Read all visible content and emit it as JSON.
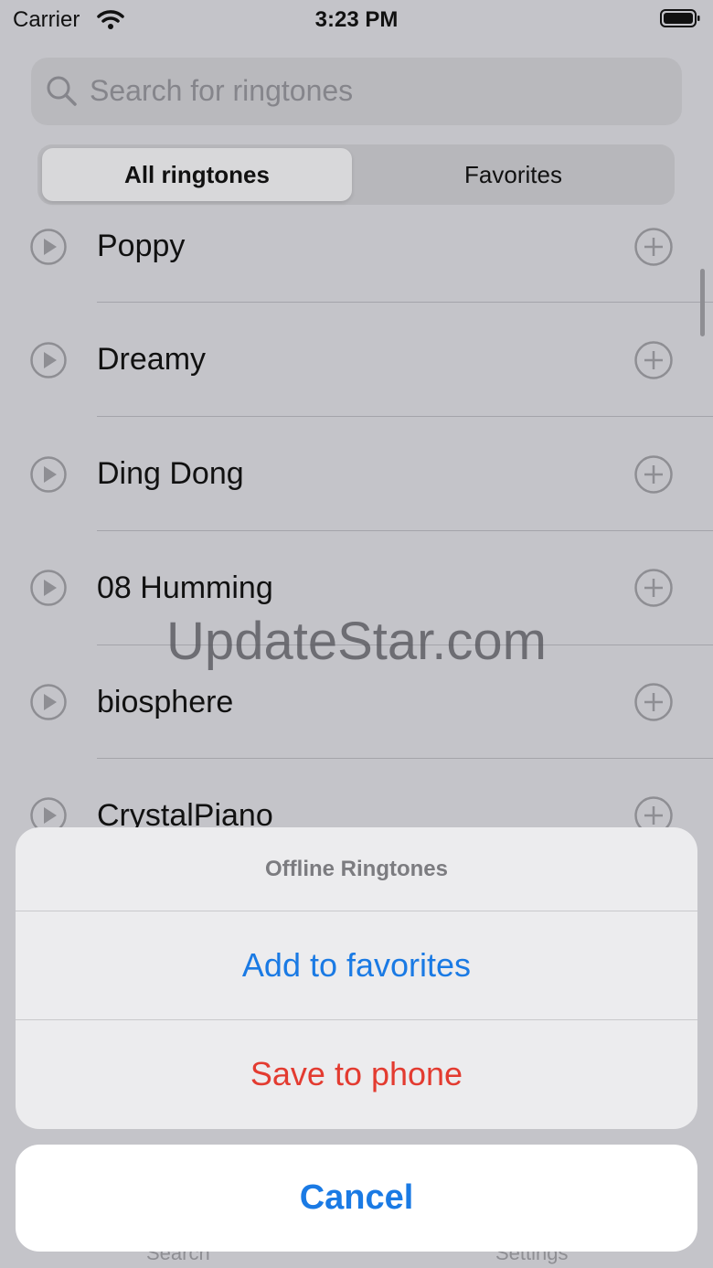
{
  "status": {
    "carrier": "Carrier",
    "time": "3:23 PM"
  },
  "search": {
    "placeholder": "Search for ringtones"
  },
  "segments": {
    "all": "All ringtones",
    "favorites": "Favorites",
    "selected": "All ringtones"
  },
  "ringtones": [
    {
      "name": "Poppy"
    },
    {
      "name": "Dreamy"
    },
    {
      "name": "Ding Dong"
    },
    {
      "name": "08 Humming"
    },
    {
      "name": "biosphere"
    },
    {
      "name": "CrystalPiano"
    }
  ],
  "watermark": "UpdateStar.com",
  "tabbar": {
    "left": "Search",
    "right": "Settings"
  },
  "action_sheet": {
    "title": "Offline Ringtones",
    "add_label": "Add to favorites",
    "save_label": "Save to phone",
    "cancel_label": "Cancel"
  },
  "colors": {
    "accent": "#1a7ae4",
    "destructive": "#e33b30"
  },
  "icons": [
    "wifi-icon",
    "battery-icon",
    "search-icon",
    "play-icon",
    "plus-icon"
  ]
}
